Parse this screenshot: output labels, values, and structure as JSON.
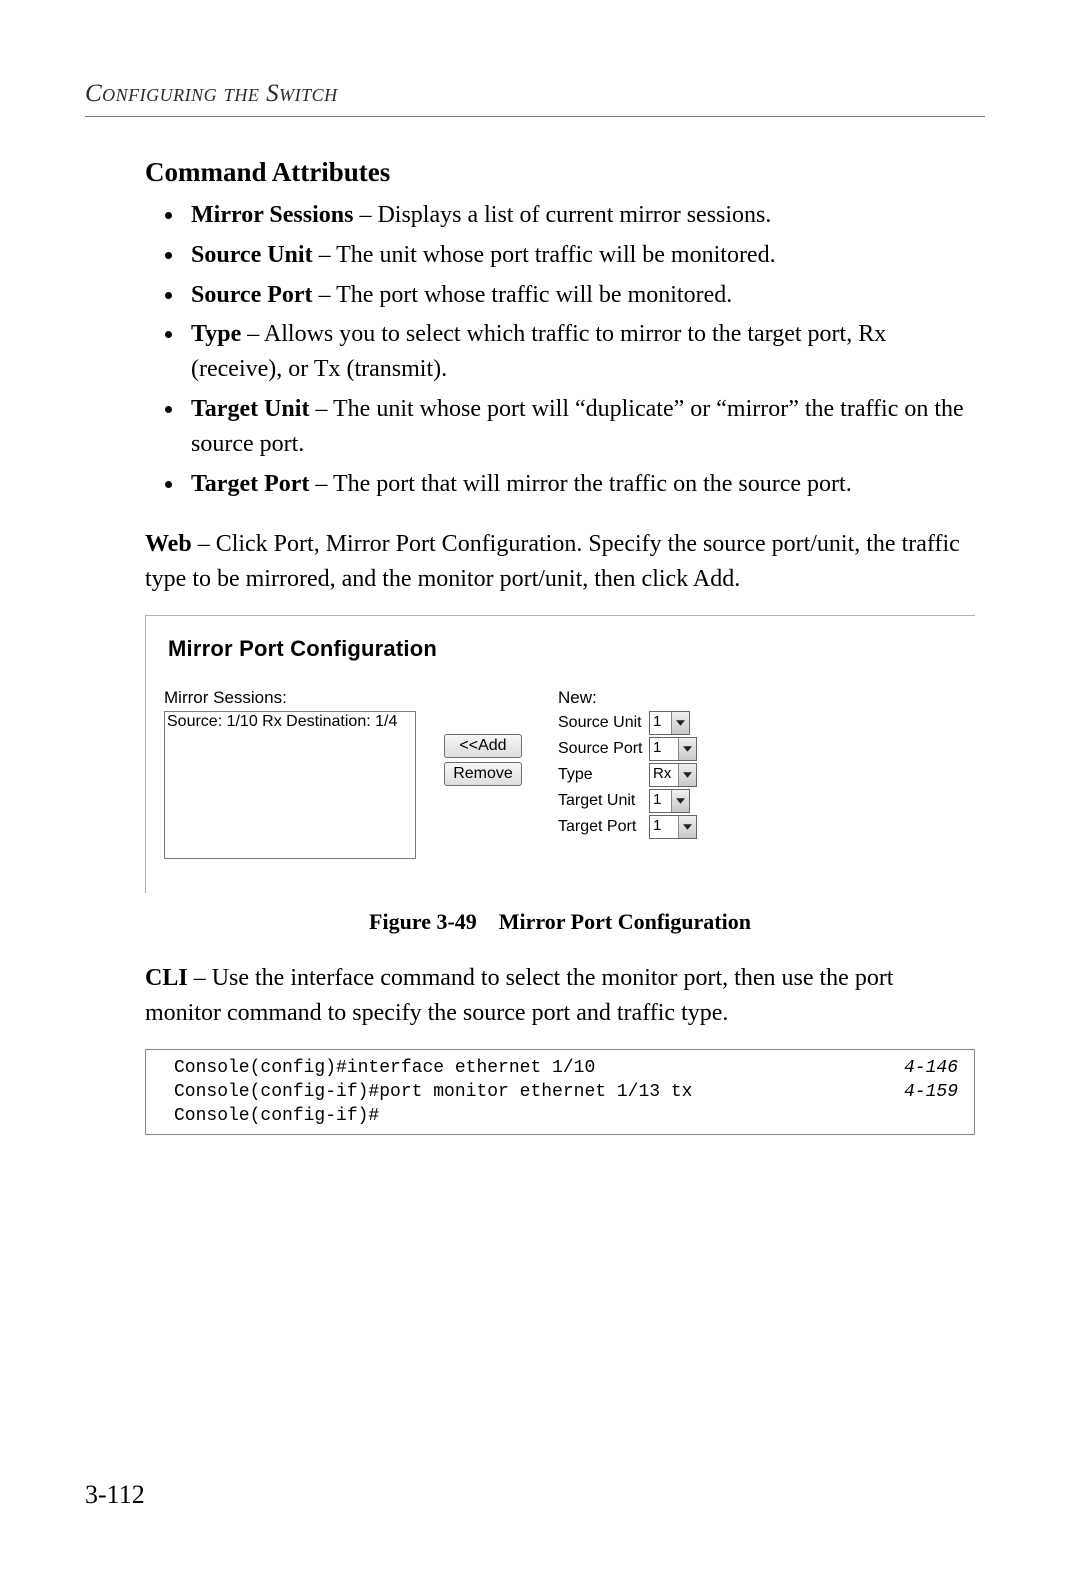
{
  "header": {
    "running_head": "Configuring the Switch"
  },
  "section_title": "Command Attributes",
  "attributes": [
    {
      "term": "Mirror Sessions",
      "desc": " – Displays a list of current mirror sessions."
    },
    {
      "term": "Source Unit",
      "desc": " – The unit whose port traffic will be monitored."
    },
    {
      "term": "Source Port",
      "desc": " – The port whose traffic will be monitored."
    },
    {
      "term": "Type",
      "desc": " – Allows you to select which traffic to mirror to the target port, Rx (receive), or Tx (transmit)."
    },
    {
      "term": "Target Unit",
      "desc": " – The unit whose port will “duplicate” or “mirror” the traffic on the source port."
    },
    {
      "term": "Target Port",
      "desc": " – The port that will mirror the traffic on the source port."
    }
  ],
  "web_para": {
    "lead": "Web",
    "text": " – Click Port, Mirror Port Configuration. Specify the source port/unit, the traffic type to be mirrored, and the monitor port/unit, then click Add."
  },
  "shot": {
    "title": "Mirror Port Configuration",
    "sessions_label": "Mirror Sessions:",
    "sessions_entry": "Source: 1/10 Rx Destination: 1/4",
    "new_label": "New:",
    "btn_add": "<<Add",
    "btn_remove": "Remove",
    "fields": {
      "source_unit": {
        "label": "Source Unit",
        "value": "1"
      },
      "source_port": {
        "label": "Source Port",
        "value": "1"
      },
      "type": {
        "label": "Type",
        "value": "Rx"
      },
      "target_unit": {
        "label": "Target Unit",
        "value": "1"
      },
      "target_port": {
        "label": "Target Port",
        "value": "1"
      }
    }
  },
  "figure_caption": "Figure 3-49 Mirror Port Configuration",
  "cli_para": {
    "lead": "CLI",
    "text": " – Use the interface command to select the monitor port, then use the port monitor command to specify the source port and traffic type."
  },
  "cli": {
    "lines": [
      {
        "cmd": "Console(config)#interface ethernet 1/10",
        "ref": "4-146"
      },
      {
        "cmd": "Console(config-if)#port monitor ethernet 1/13 tx",
        "ref": "4-159"
      },
      {
        "cmd": "Console(config-if)#",
        "ref": ""
      }
    ]
  },
  "page_number": "3-112"
}
